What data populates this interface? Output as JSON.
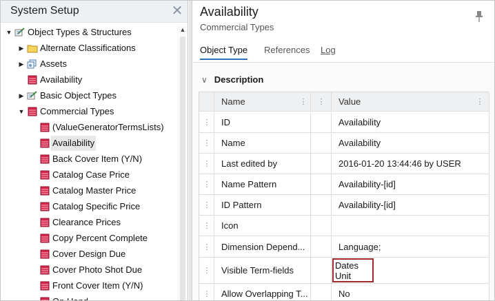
{
  "left_panel": {
    "title": "System Setup",
    "close_glyph": "✕",
    "tree": [
      {
        "label": "Object Types & Structures",
        "expanded": true,
        "icon": "structure-icon"
      },
      {
        "label": "Alternate Classifications",
        "expanded": false,
        "icon": "folder-icon"
      },
      {
        "label": "Assets",
        "expanded": false,
        "icon": "assets-icon"
      },
      {
        "label": "Availability",
        "icon": "attribute-icon"
      },
      {
        "label": "Basic Object Types",
        "expanded": false,
        "icon": "structure-icon"
      },
      {
        "label": "Commercial Types",
        "expanded": true,
        "icon": "attribute-icon"
      },
      {
        "label": "(ValueGeneratorTermsLists)",
        "icon": "attribute-icon"
      },
      {
        "label": "Availability",
        "icon": "attribute-icon",
        "selected": true
      },
      {
        "label": "Back Cover Item (Y/N)",
        "icon": "attribute-icon"
      },
      {
        "label": "Catalog Case Price",
        "icon": "attribute-icon"
      },
      {
        "label": "Catalog Master Price",
        "icon": "attribute-icon"
      },
      {
        "label": "Catalog Specific Price",
        "icon": "attribute-icon"
      },
      {
        "label": "Clearance Prices",
        "icon": "attribute-icon"
      },
      {
        "label": "Copy Percent Complete",
        "icon": "attribute-icon"
      },
      {
        "label": "Cover Design Due",
        "icon": "attribute-icon"
      },
      {
        "label": "Cover Photo Shot Due",
        "icon": "attribute-icon"
      },
      {
        "label": "Front Cover Item (Y/N)",
        "icon": "attribute-icon"
      },
      {
        "label": "On Hand",
        "icon": "attribute-icon"
      }
    ]
  },
  "right_panel": {
    "title": "Availability",
    "subtitle": "Commercial Types",
    "tabs": [
      {
        "label": "Object Type",
        "active": true
      },
      {
        "label": "References"
      },
      {
        "label": "Log"
      }
    ],
    "section_title": "Description",
    "grid": {
      "columns": [
        "Name",
        "Value"
      ],
      "rows": [
        {
          "name": "ID",
          "value": "Availability"
        },
        {
          "name": "Name",
          "value": "Availability"
        },
        {
          "name": "Last edited by",
          "value": "2016-01-20 13:44:46 by USER"
        },
        {
          "name": "Name Pattern",
          "value": "Availability-[id]"
        },
        {
          "name": "ID Pattern",
          "value": "Availability-[id]"
        },
        {
          "name": "Icon",
          "value": ""
        },
        {
          "name": "Dimension Depend...",
          "value": "Language;"
        },
        {
          "name": "Visible Term-fields",
          "value_lines": [
            "Dates",
            "Unit"
          ]
        },
        {
          "name": "Allow Overlapping T...",
          "value": "No"
        }
      ]
    }
  },
  "colors": {
    "highlight_border": "#9e2a2b",
    "active_tab_underline": "#2f6fb4",
    "header_bg": "#eef1f4"
  }
}
